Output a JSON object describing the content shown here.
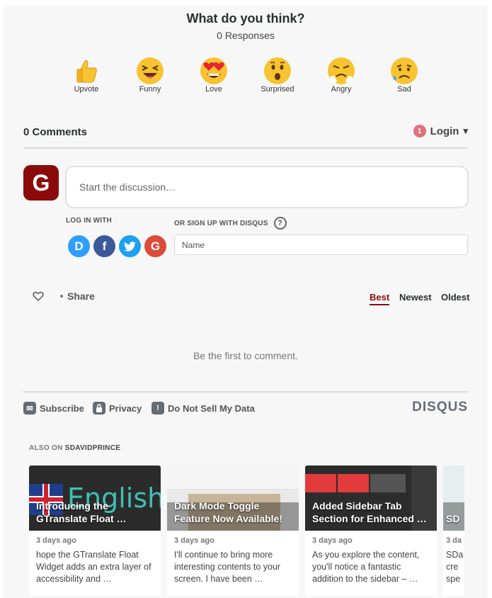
{
  "reactions": {
    "title": "What do you think?",
    "responses": "0 Responses",
    "items": [
      {
        "label": "Upvote",
        "icon": "thumbs-up-icon"
      },
      {
        "label": "Funny",
        "icon": "laughing-face-icon"
      },
      {
        "label": "Love",
        "icon": "heart-eyes-face-icon"
      },
      {
        "label": "Surprised",
        "icon": "surprised-face-icon"
      },
      {
        "label": "Angry",
        "icon": "angry-face-icon"
      },
      {
        "label": "Sad",
        "icon": "sad-face-icon"
      }
    ]
  },
  "comments": {
    "count_label": "0 Comments",
    "login_badge": "1",
    "login_label": "Login",
    "login_caret": "▾"
  },
  "composer": {
    "avatar_letter": "G",
    "placeholder": "Start the discussion…"
  },
  "auth": {
    "login_with": "LOG IN WITH",
    "signup_with": "OR SIGN UP WITH DISQUS",
    "help": "?",
    "providers": [
      {
        "name": "disqus",
        "glyph": "D",
        "color": "#2e9fff"
      },
      {
        "name": "facebook",
        "glyph": "f",
        "color": "#3b5998"
      },
      {
        "name": "twitter",
        "glyph": "t",
        "color": "#1da1f2"
      },
      {
        "name": "google",
        "glyph": "G",
        "color": "#dd4b39"
      }
    ],
    "name_placeholder": "Name"
  },
  "toolbar": {
    "share_label": "Share",
    "sort": [
      "Best",
      "Newest",
      "Oldest"
    ],
    "active_sort": "Best"
  },
  "empty_message": "Be the first to comment.",
  "footer": {
    "subscribe": "Subscribe",
    "privacy": "Privacy",
    "do_not_sell": "Do Not Sell My Data",
    "brand": "DISQUS"
  },
  "also_on": {
    "prefix": "ALSO ON",
    "site": "SDAVIDPRINCE",
    "cards": [
      {
        "title": "Introducing the GTranslate Float …",
        "date": "3 days ago",
        "excerpt": "hope the  GTranslate Float Widget adds an extra layer of accessibility and …"
      },
      {
        "title": "Dark Mode Toggle Feature Now Available!",
        "date": "3 days ago",
        "excerpt": "I'll continue to bring more interesting contents to your screen. I have been …"
      },
      {
        "title": "Added Sidebar Tab Section for Enhanced …",
        "date": "3 days ago",
        "excerpt": "As you explore the content, you'll notice a fantastic addition to the sidebar – …"
      },
      {
        "title": "SD",
        "date": "3 da",
        "excerpt": "SDa cre spe"
      }
    ]
  },
  "colors": {
    "brand_red": "#8b0b0b",
    "panel_bg": "#f7f7f7",
    "notif": "#e0707a"
  }
}
